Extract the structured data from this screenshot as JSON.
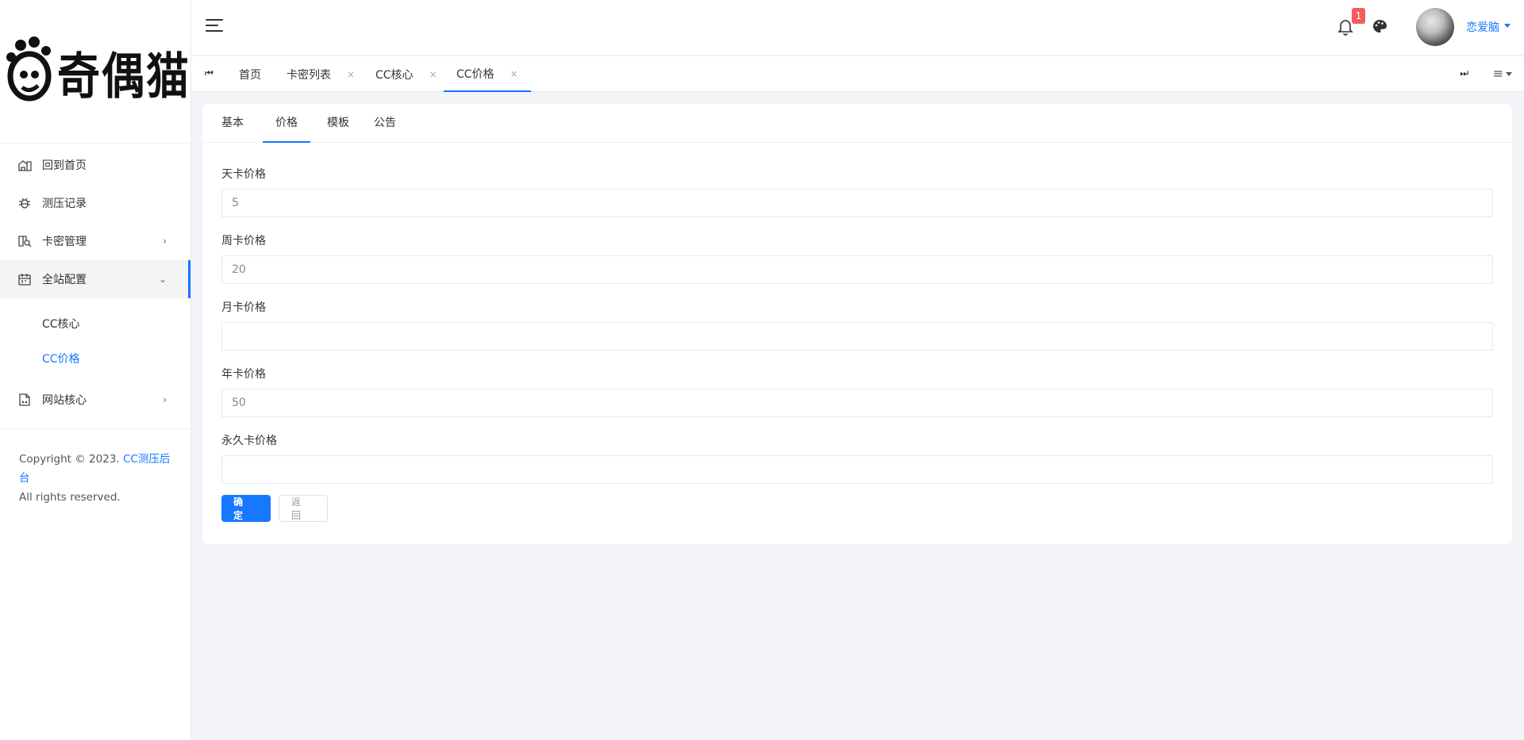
{
  "sidebar": {
    "logo_text": "奇偶猫",
    "menu": [
      {
        "label": "回到首页",
        "icon": "home-icon"
      },
      {
        "label": "测压记录",
        "icon": "bug-icon"
      },
      {
        "label": "卡密管理",
        "icon": "card-search-icon",
        "arrow": "›"
      },
      {
        "label": "全站配置",
        "icon": "calendar-icon",
        "arrow": "⌄"
      },
      {
        "label": "网站核心",
        "icon": "document-icon",
        "arrow": "›"
      }
    ],
    "submenu": [
      {
        "label": "CC核心"
      },
      {
        "label": "CC价格"
      }
    ],
    "copyright_prefix": "Copyright © 2023.",
    "copyright_link": "CC测压后台",
    "copyright_suffix": "All rights reserved."
  },
  "header": {
    "notification_count": "1",
    "username": "恋爱脑"
  },
  "tabs": [
    {
      "label": "首页"
    },
    {
      "label": "卡密列表",
      "close": "×"
    },
    {
      "label": "CC核心",
      "close": "×"
    },
    {
      "label": "CC价格",
      "close": "×"
    }
  ],
  "card": {
    "tabs": [
      "基本",
      "价格",
      "模板",
      "公告"
    ],
    "fields": [
      {
        "label": "天卡价格",
        "value": "5"
      },
      {
        "label": "周卡价格",
        "value": "20"
      },
      {
        "label": "月卡价格",
        "value": ""
      },
      {
        "label": "年卡价格",
        "value": "50"
      },
      {
        "label": "永久卡价格",
        "value": ""
      }
    ],
    "confirm_label": "确定",
    "back_label": "返回"
  },
  "colors": {
    "accent": "#1677ff",
    "badge": "#f45c5c",
    "background": "#f2f4f8"
  }
}
